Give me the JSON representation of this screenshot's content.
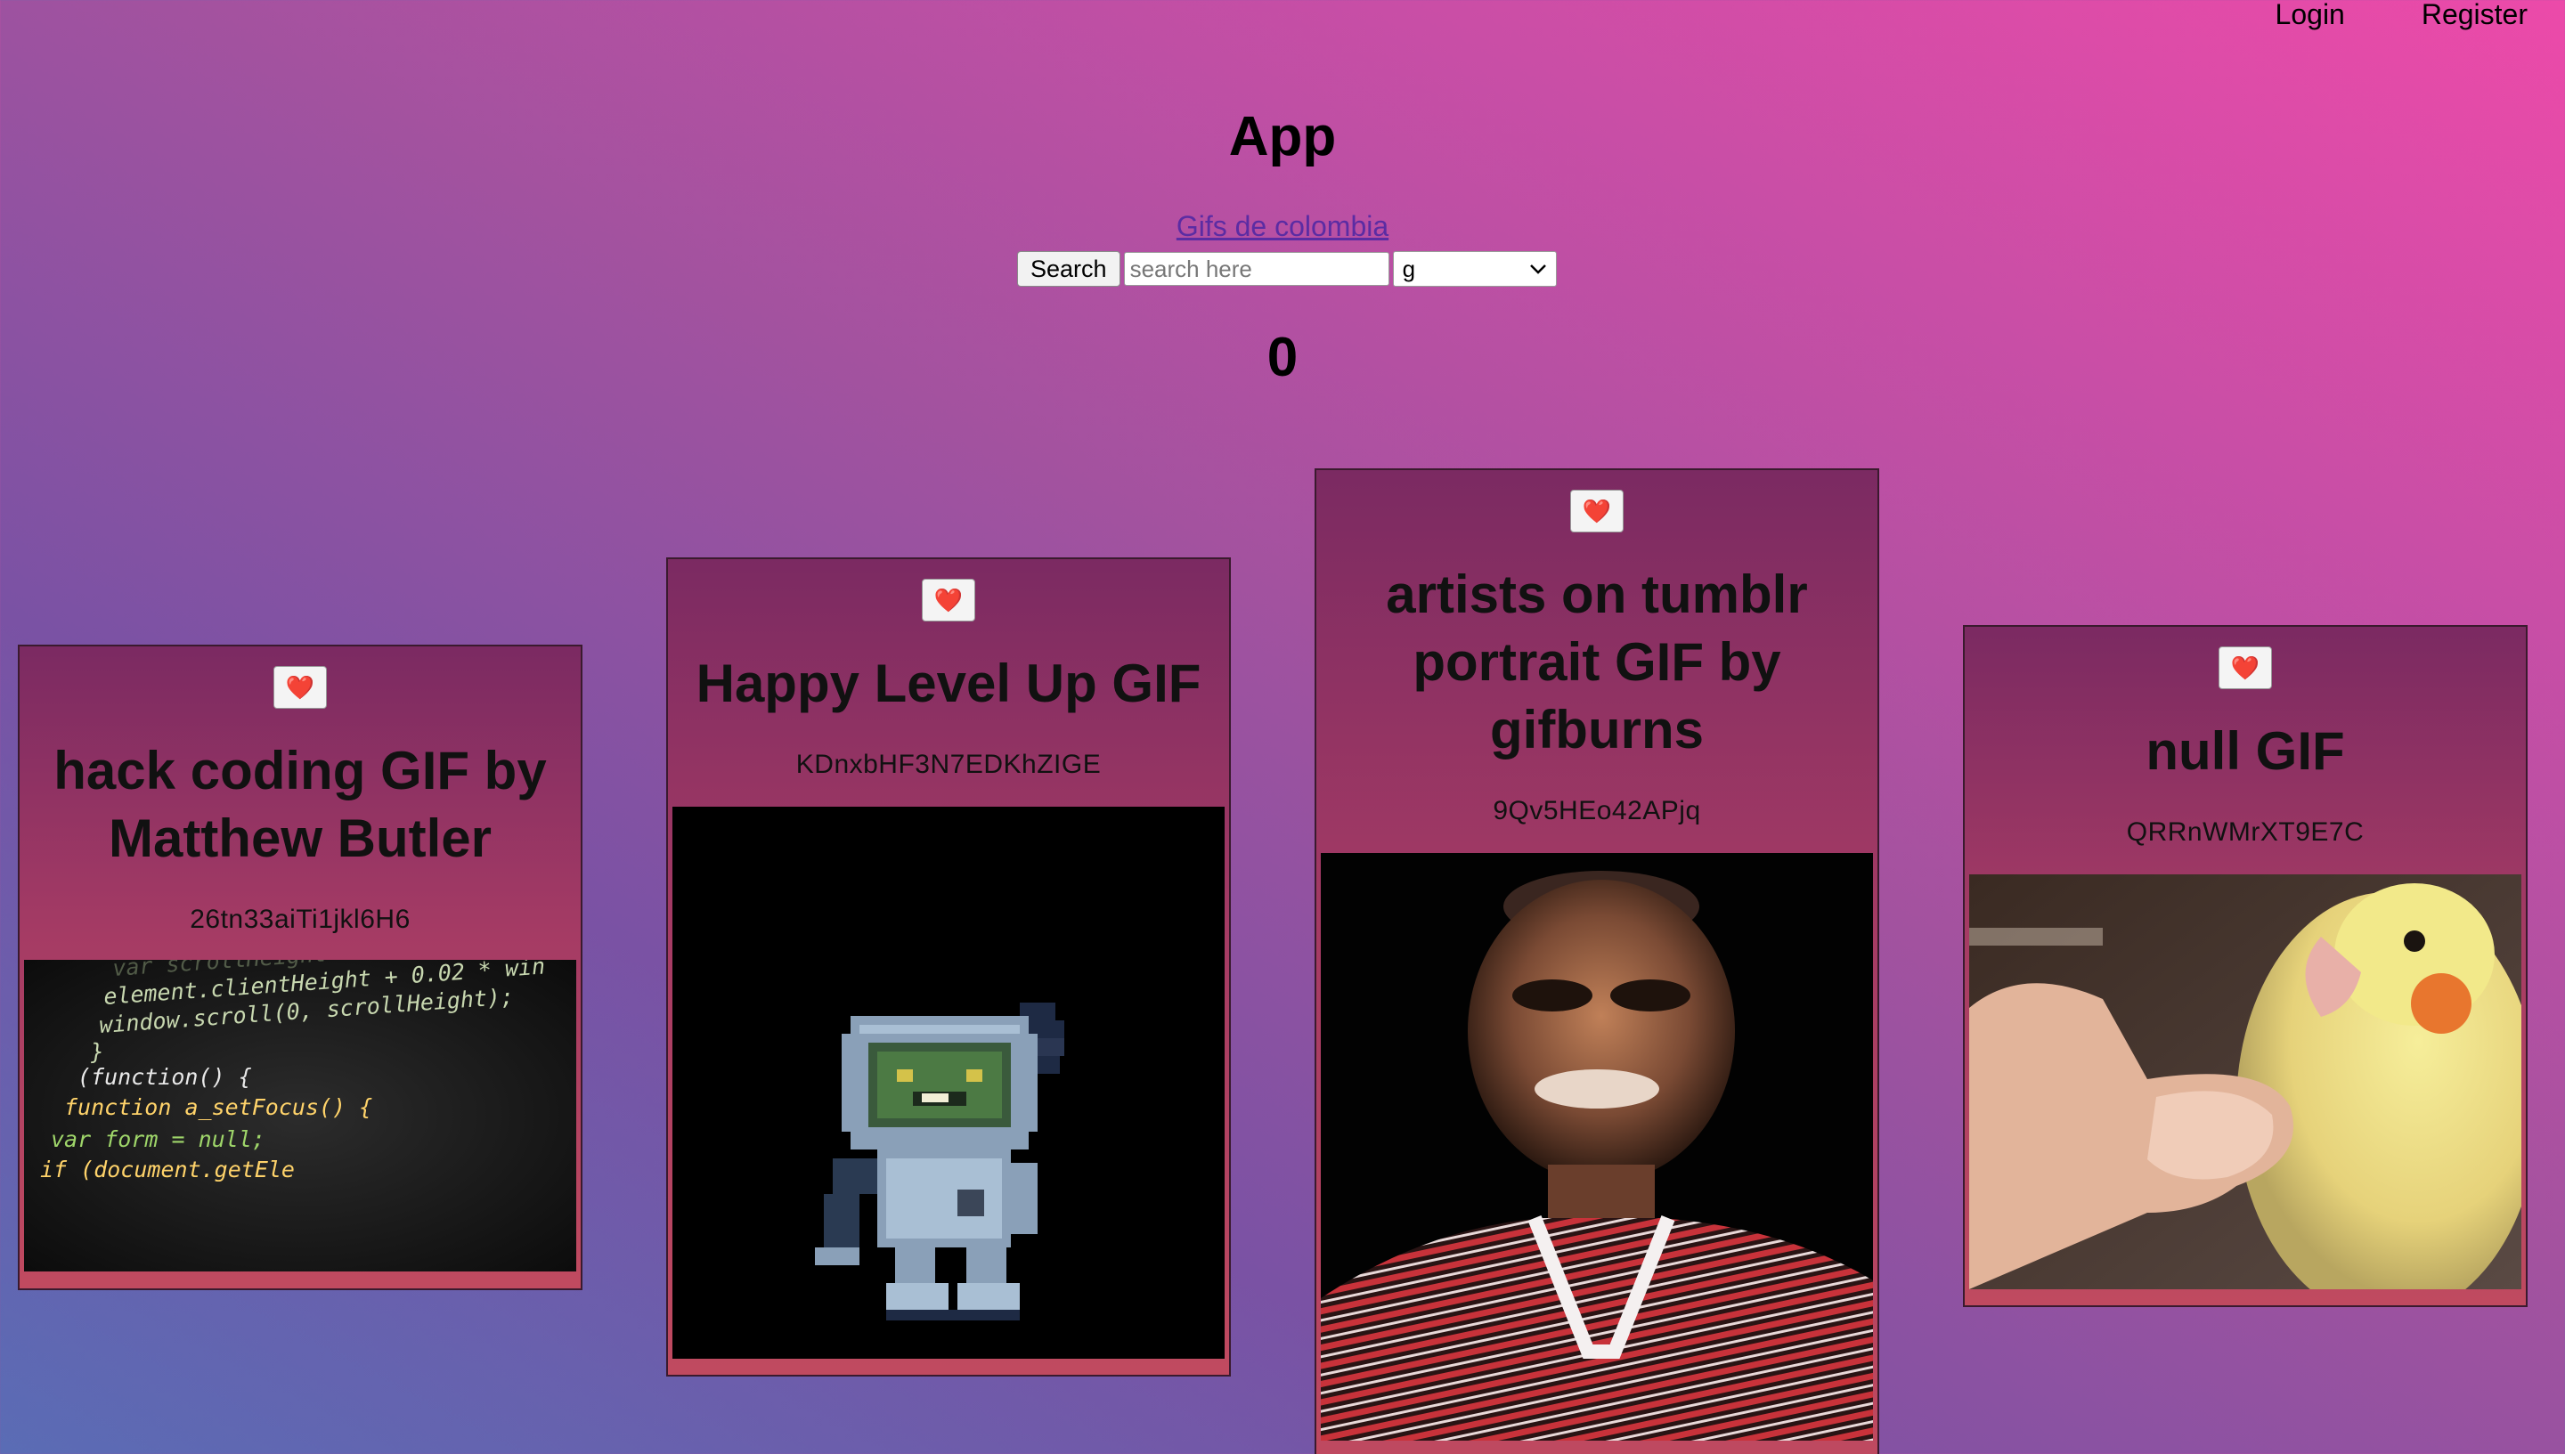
{
  "nav": {
    "login": "Login",
    "register": "Register"
  },
  "header": {
    "title": "App",
    "link": "Gifs de colombia"
  },
  "search": {
    "button_label": "Search",
    "placeholder": "search here",
    "value": "",
    "select_value": "g"
  },
  "counter": "0",
  "cards": [
    {
      "heart": "❤️",
      "title": "hack coding GIF by Matthew Butler",
      "id": "26tn33aiTi1jkl6H6",
      "image_icon": "code-screen-image",
      "code_lines": [
        "var scrollHeight",
        "element.clientHeight + 0.02 * win",
        "window.scroll(0, scrollHeight);",
        "}",
        "(function() {",
        "function a_setFocus() {",
        "var form = null;",
        "if (document.getEle"
      ]
    },
    {
      "heart": "❤️",
      "title": "Happy Level Up GIF",
      "id": "KDnxbHF3N7EDKhZIGE",
      "image_icon": "pixel-robot-image"
    },
    {
      "heart": "❤️",
      "title": "artists on tumblr portrait GIF by gifburns",
      "id": "9Qv5HEo42APjq",
      "image_icon": "portrait-person-image"
    },
    {
      "heart": "❤️",
      "title": "null GIF",
      "id": "QRRnWMrXT9E7C",
      "image_icon": "cockatiel-bird-image"
    }
  ]
}
